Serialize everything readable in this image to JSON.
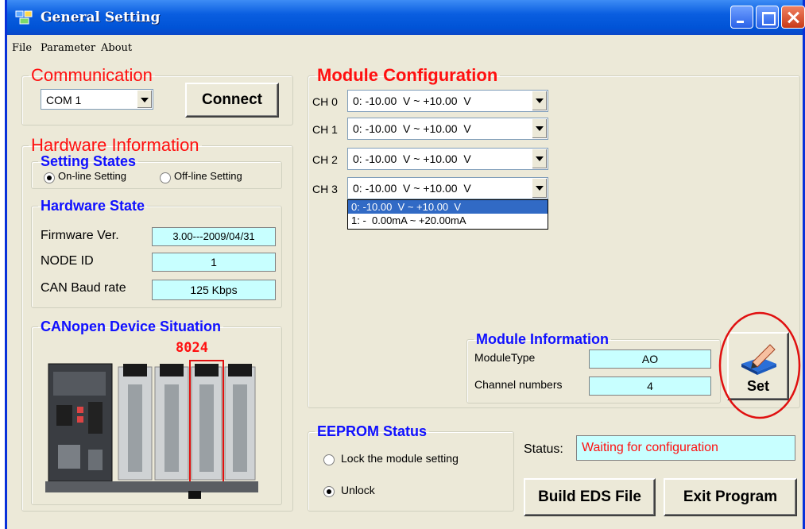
{
  "window": {
    "title": "General Setting"
  },
  "menu": [
    "File",
    "Parameter",
    "About"
  ],
  "communication": {
    "legend": "Communication",
    "port_value": "COM 1",
    "connect_label": "Connect"
  },
  "hardware": {
    "legend": "Hardware Information",
    "setting_states": {
      "legend": "Setting States",
      "online_label": "On-line Setting",
      "offline_label": "Off-line Setting",
      "selected": "online"
    },
    "state": {
      "legend": "Hardware State",
      "firmware_label": "Firmware Ver.",
      "firmware_value": "3.00---2009/04/31",
      "node_label": "NODE ID",
      "node_value": "1",
      "baud_label": "CAN Baud rate",
      "baud_value": "125  Kbps"
    },
    "device": {
      "legend": "CANopen Device Situation",
      "module_name": "8024"
    }
  },
  "module_config": {
    "legend": "Module Configuration",
    "channels": [
      {
        "label": "CH 0",
        "value": "0: -10.00  V ~ +10.00  V"
      },
      {
        "label": "CH 1",
        "value": "0: -10.00  V ~ +10.00  V"
      },
      {
        "label": "CH 2",
        "value": "0: -10.00  V ~ +10.00  V"
      },
      {
        "label": "CH 3",
        "value": "0: -10.00  V ~ +10.00  V"
      }
    ],
    "dropdown_options": [
      "0: -10.00  V ~ +10.00  V",
      "1: -  0.00mA ~ +20.00mA"
    ]
  },
  "module_info": {
    "legend": "Module Information",
    "type_label": "ModuleType",
    "type_value": "AO",
    "channels_label": "Channel numbers",
    "channels_value": "4"
  },
  "set_button": {
    "label": "Set"
  },
  "eeprom": {
    "legend": "EEPROM Status",
    "lock_label": "Lock the module setting",
    "unlock_label": "Unlock",
    "selected": "unlock"
  },
  "status": {
    "label": "Status:",
    "value": "Waiting for configuration"
  },
  "buttons": {
    "build_eds": "Build EDS File",
    "exit": "Exit Program"
  },
  "colors": {
    "legend_red": "#ff1010",
    "legend_blue": "#1010ff",
    "field_cyan": "#c8ffff",
    "selection": "#316ac5",
    "annotation_circle": "#e01010"
  }
}
